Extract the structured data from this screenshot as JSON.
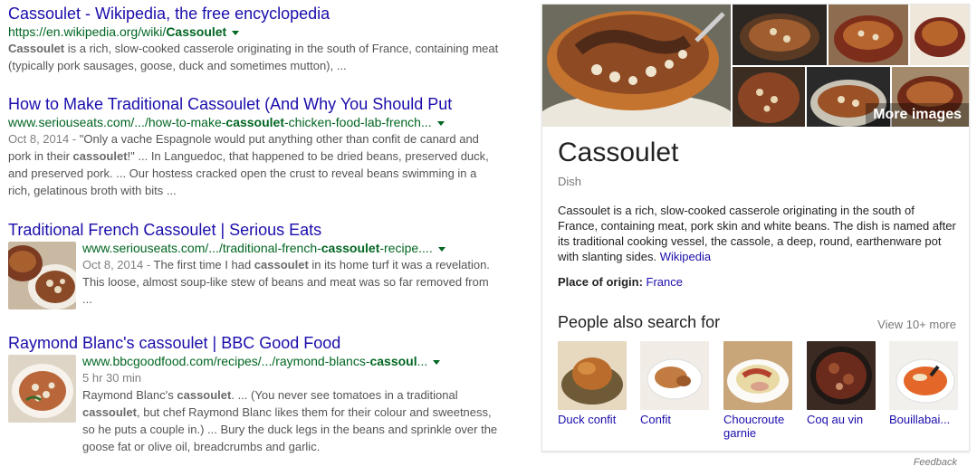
{
  "results": [
    {
      "title": "Cassoulet - Wikipedia, the free encyclopedia",
      "url_pre": "https://en.wikipedia.org/wiki/",
      "url_bold": "Cassoulet",
      "url_post": "",
      "snippet": [
        {
          "b": true,
          "t": "Cassoulet"
        },
        {
          "b": false,
          "t": " is a rich, slow-cooked casserole originating in the south of France, containing meat (typically pork sausages, goose, duck and sometimes mutton), ..."
        }
      ]
    },
    {
      "title": "How to Make Traditional Cassoulet (And Why You Should Put",
      "url_pre": "www.seriouseats.com/.../how-to-make-",
      "url_bold": "cassoulet",
      "url_post": "-chicken-food-lab-french...",
      "date": "Oct 8, 2014 - ",
      "snippet": [
        {
          "b": false,
          "t": "\"Only a vache Espagnole would put anything other than confit de canard and pork in their "
        },
        {
          "b": true,
          "t": "cassoulet"
        },
        {
          "b": false,
          "t": "!\" ... In Languedoc, that happened to be dried beans, preserved duck, and preserved pork. ... Our hostess cracked open the crust to reveal beans swimming in a rich, gelatinous broth with bits ..."
        }
      ]
    },
    {
      "title": "Traditional French Cassoulet | Serious Eats",
      "url_pre": "www.seriouseats.com/.../traditional-french-",
      "url_bold": "cassoulet",
      "url_post": "-recipe....",
      "date": "Oct 8, 2014 - ",
      "snippet": [
        {
          "b": false,
          "t": "The first time I had "
        },
        {
          "b": true,
          "t": "cassoulet"
        },
        {
          "b": false,
          "t": " in its home turf it was a revelation. This loose, almost soup-like stew of beans and meat was so far removed from ..."
        }
      ]
    },
    {
      "title": "Raymond Blanc's cassoulet | BBC Good Food",
      "url_pre": "www.bbcgoodfood.com/recipes/.../raymond-blancs-",
      "url_bold": "cassoul",
      "url_post": "...",
      "duration": "5 hr 30 min",
      "snippet": [
        {
          "b": false,
          "t": "Raymond Blanc's "
        },
        {
          "b": true,
          "t": "cassoulet"
        },
        {
          "b": false,
          "t": ". ... (You never see tomatoes in a traditional "
        },
        {
          "b": true,
          "t": "cassoulet"
        },
        {
          "b": false,
          "t": ", but chef Raymond Blanc likes them for their colour and sweetness, so he puts a couple in.) ... Bury the duck legs in the beans and sprinkle over the goose fat or olive oil, breadcrumbs and garlic."
        }
      ]
    }
  ],
  "panel": {
    "more_images": "More images",
    "title": "Cassoulet",
    "subtitle": "Dish",
    "description": "Cassoulet is a rich, slow-cooked casserole originating in the south of France, containing meat, pork skin and white beans. The dish is named after its traditional cooking vessel, the cassole, a deep, round, earthenware pot with slanting sides. ",
    "description_link": "Wikipedia",
    "origin_label": "Place of origin: ",
    "origin_value": "France",
    "pasf_heading": "People also search for",
    "view_more": "View 10+ more",
    "pasf": [
      {
        "label": "Duck confit"
      },
      {
        "label": "Confit"
      },
      {
        "label": "Choucroute garnie"
      },
      {
        "label": "Coq au vin"
      },
      {
        "label": "Bouillabai..."
      }
    ],
    "feedback": "Feedback"
  },
  "colors": {
    "link": "#1a0dab",
    "url": "#006621",
    "snippet": "#545454"
  }
}
